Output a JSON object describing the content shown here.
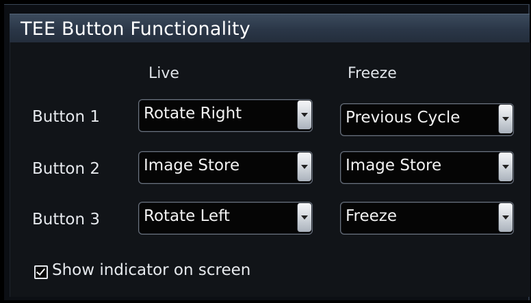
{
  "panel": {
    "title": "TEE Button Functionality",
    "columns": {
      "live": "Live",
      "freeze": "Freeze"
    },
    "rows": [
      {
        "label": "Button 1",
        "live": "Rotate Right",
        "freeze": "Previous Cycle"
      },
      {
        "label": "Button 2",
        "live": "Image Store",
        "freeze": "Image Store"
      },
      {
        "label": "Button 3",
        "live": "Rotate Left",
        "freeze": "Freeze"
      }
    ],
    "show_indicator": {
      "label": "Show indicator on screen",
      "checked": true
    }
  },
  "icons": {
    "dropdown": "chevron-down-icon",
    "check": "checkmark-icon"
  },
  "colors": {
    "header_bg": "#2a3647",
    "panel_bg": "#111418",
    "text": "#e4e8ee"
  }
}
